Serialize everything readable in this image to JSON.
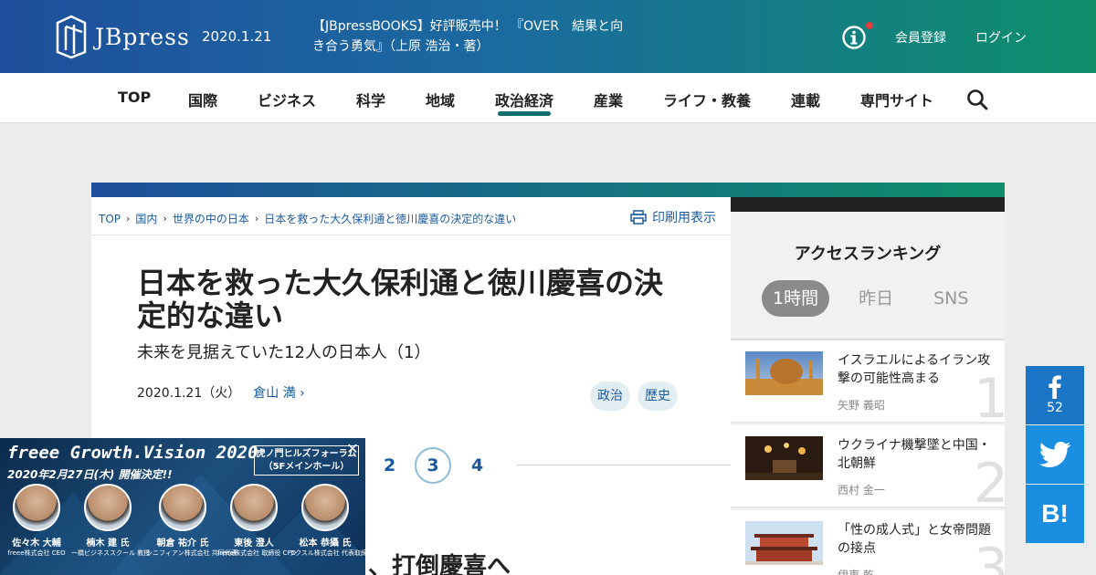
{
  "header": {
    "logo_text": "JBpress",
    "date": "2020.1.21",
    "promo": "【JBpressBOOKS】好評販売中！ 『OVER　結果と向き合う勇気』（上原 浩治・著）",
    "register": "会員登録",
    "login": "ログイン"
  },
  "nav": {
    "items": [
      {
        "label": "TOP"
      },
      {
        "label": "国際"
      },
      {
        "label": "ビジネス"
      },
      {
        "label": "科学"
      },
      {
        "label": "地域"
      },
      {
        "label": "政治経済"
      },
      {
        "label": "産業"
      },
      {
        "label": "ライフ・教養"
      },
      {
        "label": "連載"
      },
      {
        "label": "専門サイト"
      }
    ],
    "active": "政治経済"
  },
  "breadcrumb": [
    "TOP",
    "国内",
    "世界の中の日本",
    "日本を救った大久保利通と徳川慶喜の決定的な違い"
  ],
  "print_label": "印刷用表示",
  "article": {
    "title": "日本を救った大久保利通と徳川慶喜の決定的な違い",
    "subtitle": "未来を見据えていた12人の日本人（1）",
    "date": "2020.1.21（火）",
    "author": "倉山 満",
    "tags": [
      "政治",
      "歴史"
    ],
    "pages": [
      "2",
      "3",
      "4"
    ],
    "current_page": "3",
    "section_heading_fragment": "、打倒慶喜へ"
  },
  "sidebar": {
    "title": "アクセスランキング",
    "tabs": [
      "1時間",
      "昨日",
      "SNS"
    ],
    "active_tab": "1時間",
    "rankings": [
      {
        "num": "1",
        "title": "イスラエルによるイラン攻撃の可能性高まる",
        "author": "矢野 義昭"
      },
      {
        "num": "2",
        "title": "ウクライナ機撃墜と中国・北朝鮮",
        "author": "西村 金一"
      },
      {
        "num": "3",
        "title": "「性の成人式」と女帝問題の接点",
        "author": "伊東 乾"
      }
    ]
  },
  "share": {
    "fb_count": "52",
    "hatena_label": "B!"
  },
  "ad": {
    "title": "freee Growth.Vision 2020",
    "date": "2020年2月27日(木) 開催決定!!",
    "venue": "虎ノ門ヒルズフォーラム（5Fメインホール）",
    "close": "✕",
    "speakers": [
      {
        "name": "佐々木 大輔",
        "role": "freee株式会社 CEO"
      },
      {
        "name": "楠木 建 氏",
        "role": "一橋ビジネススクール 教授"
      },
      {
        "name": "朝倉 祐介 氏",
        "role": "シニフィアン株式会社 共同代表"
      },
      {
        "name": "東後 澄人",
        "role": "freee株式会社 取締役 CFO"
      },
      {
        "name": "松本 恭攝 氏",
        "role": "ラクスル株式会社 代表取締役社長 CEO"
      }
    ]
  },
  "colors": {
    "header_start": "#1e4f9c",
    "header_end": "#0e8f6a",
    "link": "#1a5a9c",
    "active_underline": "#0f6f6c",
    "facebook": "#1a75c6",
    "twitter": "#1a8ee0"
  }
}
